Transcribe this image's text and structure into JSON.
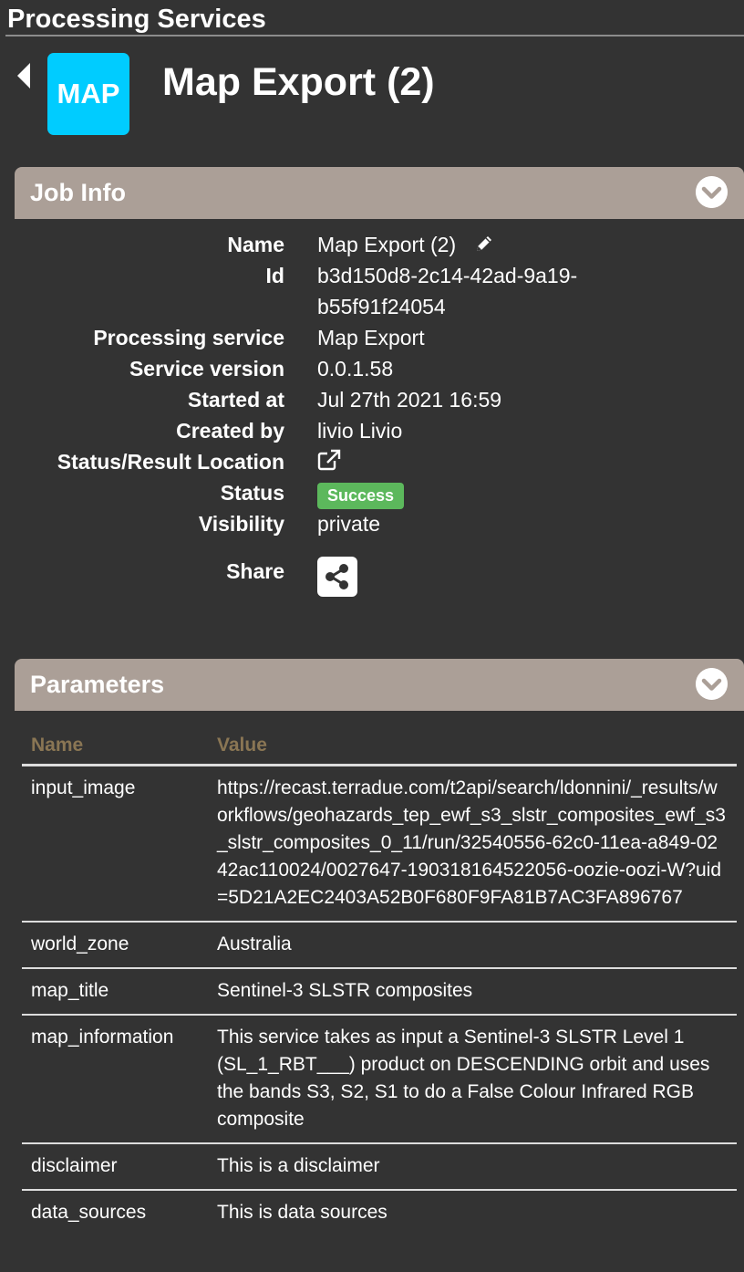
{
  "header": {
    "title": "Processing Services"
  },
  "job": {
    "logo_text": "MAP",
    "title": "Map Export (2)"
  },
  "job_info": {
    "section_title": "Job Info",
    "rows": {
      "name_label": "Name",
      "name_value": "Map Export (2)",
      "id_label": "Id",
      "id_value_line1": "b3d150d8-2c14-42ad-9a19-",
      "id_value_line2": "b55f91f24054",
      "service_label": "Processing service",
      "service_value": "Map Export",
      "version_label": "Service version",
      "version_value": "0.0.1.58",
      "started_label": "Started at",
      "started_value": "Jul 27th 2021 16:59",
      "created_label": "Created by",
      "created_value": "livio Livio",
      "location_label": "Status/Result Location",
      "status_label": "Status",
      "status_value": "Success",
      "visibility_label": "Visibility",
      "visibility_value": "private",
      "share_label": "Share"
    },
    "status_color": "#5cb85c"
  },
  "parameters": {
    "section_title": "Parameters",
    "col_name": "Name",
    "col_value": "Value",
    "rows": [
      {
        "name": "input_image",
        "value": "https://recast.terradue.com/t2api/search/ldonnini/_results/workflows/geohazards_tep_ewf_s3_slstr_composites_ewf_s3_slstr_composites_0_11/run/32540556-62c0-11ea-a849-0242ac110024/0027647-190318164522056-oozie-oozi-W?uid=5D21A2EC2403A52B0F680F9FA81B7AC3FA896767"
      },
      {
        "name": "world_zone",
        "value": "Australia"
      },
      {
        "name": "map_title",
        "value": "Sentinel-3 SLSTR composites"
      },
      {
        "name": "map_information",
        "value": "This service takes as input a Sentinel-3 SLSTR Level 1 (SL_1_RBT___) product on DESCENDING orbit and uses the bands S3, S2, S1 to do a False Colour Infrared RGB composite"
      },
      {
        "name": "disclaimer",
        "value": "This is a disclaimer"
      },
      {
        "name": "data_sources",
        "value": "This is data sources"
      }
    ]
  },
  "icons": {
    "back": "caret-left-icon",
    "edit": "pencil-icon",
    "external": "external-link-icon",
    "share": "share-icon",
    "collapse": "chevron-down-icon"
  },
  "colors": {
    "background": "#333333",
    "section_header": "#ab9f97",
    "logo": "#00ccff",
    "table_header_text": "#8a7654"
  }
}
